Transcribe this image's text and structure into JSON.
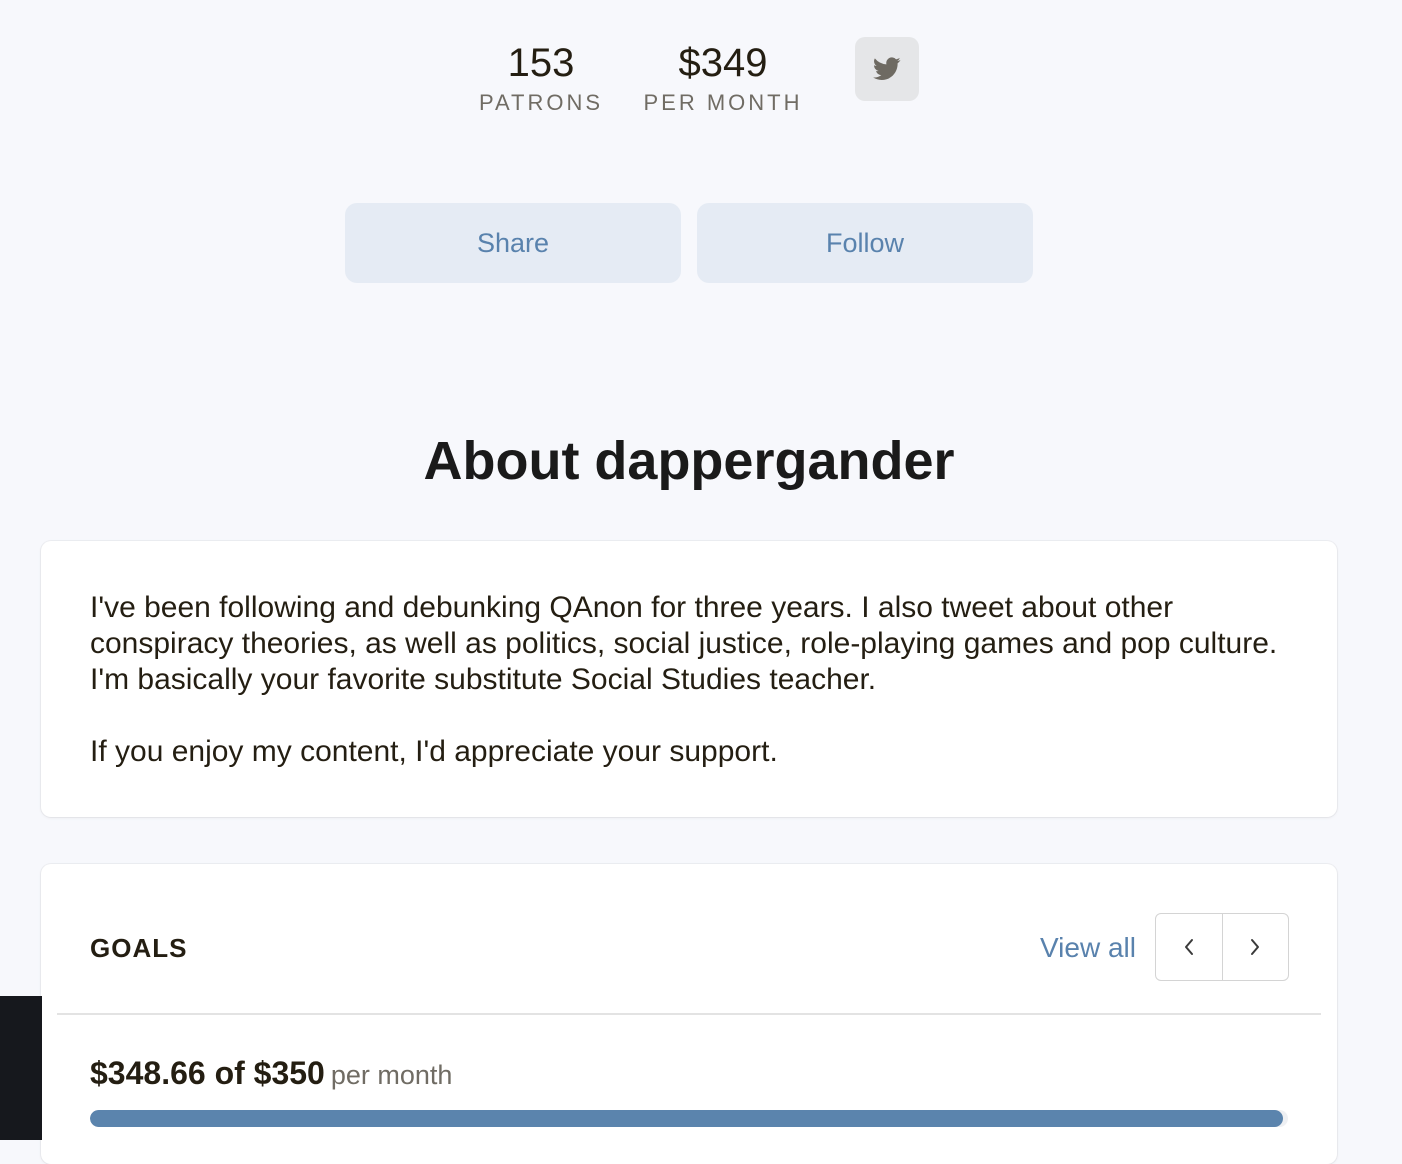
{
  "stats": {
    "patrons_value": "153",
    "patrons_label": "PATRONS",
    "monthly_value": "$349",
    "monthly_label": "PER MONTH",
    "social_icon": "twitter-icon"
  },
  "actions": {
    "share_label": "Share",
    "follow_label": "Follow"
  },
  "about": {
    "title": "About dappergander",
    "paragraph1": "I've been following and debunking QAnon for three years. I also tweet about other conspiracy theories, as well as politics, social justice, role-playing games and pop culture. I'm basically your favorite substitute Social Studies teacher.",
    "paragraph2": "If you enjoy my content, I'd appreciate your support."
  },
  "goals": {
    "title": "GOALS",
    "view_all_label": "View all",
    "prev_icon": "chevron-left-icon",
    "next_icon": "chevron-right-icon",
    "current": {
      "amount_text": "$348.66 of $350",
      "period_text": "per month",
      "raised": 348.66,
      "target": 350
    }
  },
  "colors": {
    "background": "#f7f8fc",
    "accent": "#5982ad",
    "button_bg": "#e5ebf4",
    "progress_fill": "#5b84ad",
    "text": "#241e12",
    "muted_text": "#706c64"
  }
}
